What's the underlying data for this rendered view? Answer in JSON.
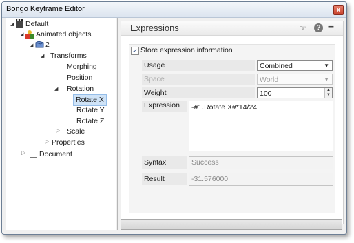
{
  "window": {
    "title": "Bongo Keyframe Editor",
    "close_glyph": "x"
  },
  "tree": {
    "items": [
      {
        "label": "Default",
        "icon": "clapper-icon"
      },
      {
        "label": "Animated objects",
        "icon": "animated-objects-icon"
      },
      {
        "label": "2",
        "icon": "object-icon"
      },
      {
        "label": "Transforms"
      },
      {
        "label": "Morphing"
      },
      {
        "label": "Position"
      },
      {
        "label": "Rotation"
      },
      {
        "label": "Rotate X",
        "selected": true
      },
      {
        "label": "Rotate Y"
      },
      {
        "label": "Rotate Z"
      },
      {
        "label": "Scale"
      },
      {
        "label": "Properties"
      },
      {
        "label": "Document",
        "icon": "document-icon"
      }
    ]
  },
  "panel": {
    "title": "Expressions",
    "checkbox_label": "Store expression information",
    "checkbox_checked": true,
    "usage_label": "Usage",
    "usage_value": "Combined",
    "space_label": "Space",
    "space_value": "World",
    "weight_label": "Weight",
    "weight_value": "100",
    "expression_label": "Expression",
    "expression_value": "-#1.Rotate X#*14/24",
    "syntax_label": "Syntax",
    "syntax_value": "Success",
    "result_label": "Result",
    "result_value": "-31.576000"
  },
  "colors": {
    "selection": "#cfe3f7",
    "close_button": "#c9432c"
  }
}
